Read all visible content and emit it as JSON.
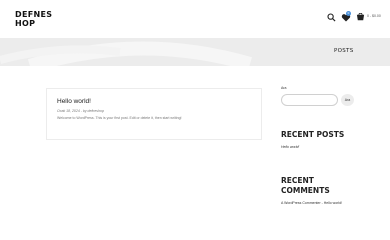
{
  "site": {
    "logo_text": "DEFNES HOP"
  },
  "header": {
    "cart_amount": "0 - $0.00",
    "wishlist_count": "0",
    "icons": [
      "search-icon",
      "heart-icon",
      "cart-icon"
    ]
  },
  "hero": {
    "title": "POSTS"
  },
  "post": {
    "title": "Hello world!",
    "meta": "Ocak 18, 2024 - by defneshop",
    "excerpt": "Welcome to WordPress. This is your first post. Edit or delete it, then start writing!"
  },
  "sidebar": {
    "search": {
      "label": "Ara",
      "placeholder": "",
      "button_label": "Ara"
    },
    "recent_posts": {
      "heading": "RECENT POSTS",
      "items": [
        "Hello world!"
      ]
    },
    "recent_comments": {
      "heading": "RECENT COMMENTS",
      "items": [
        "A WordPress Commenter - Hello world!"
      ]
    }
  },
  "colors": {
    "hero_bg": "#ececec",
    "badge": "#4a90d9",
    "text_dark": "#222222"
  }
}
